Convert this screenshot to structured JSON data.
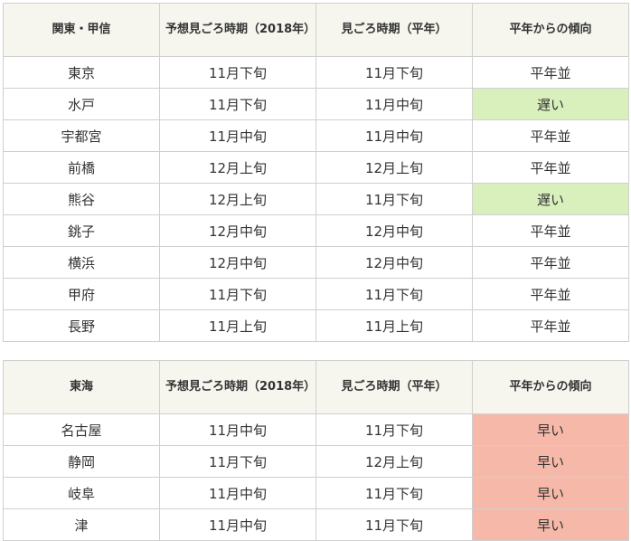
{
  "colors": {
    "header_bg": "#f6f6ef",
    "border": "#cfcfcf",
    "late": "#d9f0bd",
    "early": "#f6b8a8"
  },
  "tables": [
    {
      "headers": [
        "関東・甲信",
        "予想見ごろ時期（2018年）",
        "見ごろ時期（平年）",
        "平年からの傾向"
      ],
      "rows": [
        {
          "city": "東京",
          "forecast": "11月下旬",
          "normal": "11月下旬",
          "trend": "平年並",
          "trend_type": "normal"
        },
        {
          "city": "水戸",
          "forecast": "11月下旬",
          "normal": "11月中旬",
          "trend": "遅い",
          "trend_type": "late"
        },
        {
          "city": "宇都宮",
          "forecast": "11月中旬",
          "normal": "11月中旬",
          "trend": "平年並",
          "trend_type": "normal"
        },
        {
          "city": "前橋",
          "forecast": "12月上旬",
          "normal": "12月上旬",
          "trend": "平年並",
          "trend_type": "normal"
        },
        {
          "city": "熊谷",
          "forecast": "12月上旬",
          "normal": "11月下旬",
          "trend": "遅い",
          "trend_type": "late"
        },
        {
          "city": "銚子",
          "forecast": "12月中旬",
          "normal": "12月中旬",
          "trend": "平年並",
          "trend_type": "normal"
        },
        {
          "city": "横浜",
          "forecast": "12月中旬",
          "normal": "12月中旬",
          "trend": "平年並",
          "trend_type": "normal"
        },
        {
          "city": "甲府",
          "forecast": "11月下旬",
          "normal": "11月下旬",
          "trend": "平年並",
          "trend_type": "normal"
        },
        {
          "city": "長野",
          "forecast": "11月上旬",
          "normal": "11月上旬",
          "trend": "平年並",
          "trend_type": "normal"
        }
      ]
    },
    {
      "headers": [
        "東海",
        "予想見ごろ時期（2018年）",
        "見ごろ時期（平年）",
        "平年からの傾向"
      ],
      "rows": [
        {
          "city": "名古屋",
          "forecast": "11月中旬",
          "normal": "11月下旬",
          "trend": "早い",
          "trend_type": "early"
        },
        {
          "city": "静岡",
          "forecast": "11月下旬",
          "normal": "12月上旬",
          "trend": "早い",
          "trend_type": "early"
        },
        {
          "city": "岐阜",
          "forecast": "11月中旬",
          "normal": "11月下旬",
          "trend": "早い",
          "trend_type": "early"
        },
        {
          "city": "津",
          "forecast": "11月中旬",
          "normal": "11月下旬",
          "trend": "早い",
          "trend_type": "early"
        }
      ]
    }
  ]
}
